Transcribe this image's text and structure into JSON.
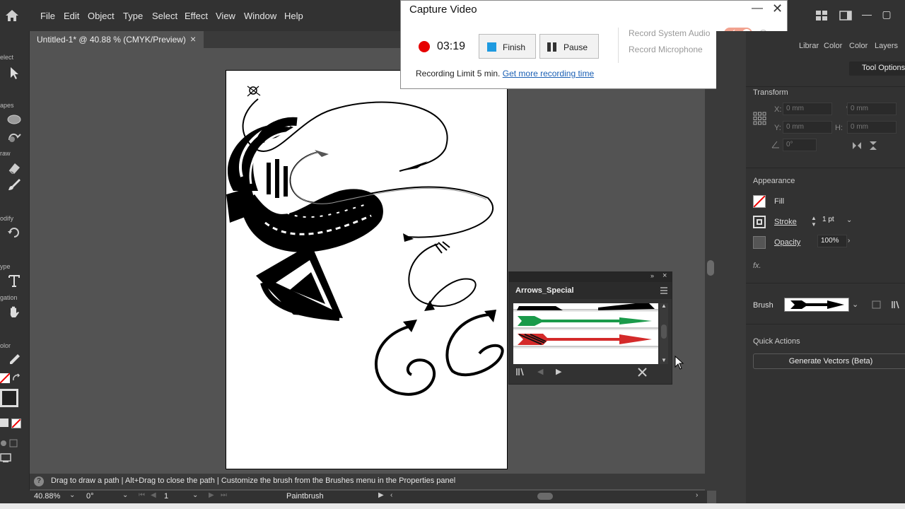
{
  "menu": {
    "items": [
      "File",
      "Edit",
      "Object",
      "Type",
      "Select",
      "Effect",
      "View",
      "Window",
      "Help"
    ]
  },
  "document": {
    "tab_title": "Untitled-1* @ 40.88 % (CMYK/Preview)",
    "close_glyph": "×"
  },
  "toolbar": {
    "headings": [
      "elect",
      "apes",
      "raw",
      "odify",
      "ype",
      "gation",
      "olor"
    ]
  },
  "capture": {
    "title": "Capture Video",
    "minimize_glyph": "—",
    "close_glyph": "✕",
    "time": "03:19",
    "finish_label": "Finish",
    "pause_label": "Pause",
    "record_system_audio": "Record System Audio",
    "record_microphone": "Record Microphone",
    "system_audio_on": true,
    "microphone_on": false,
    "limit_text": "Recording Limit 5 min.",
    "limit_link": "Get more recording time",
    "accent": "#1e9ae0",
    "record_color": "#e60000"
  },
  "right_panel": {
    "tabs": [
      "Librar",
      "Color",
      "Color",
      "Layers"
    ],
    "tool_options": "Tool Options",
    "transform": {
      "title": "Transform",
      "x_label": "X:",
      "x_value": "0 mm",
      "y_label": "Y:",
      "y_value": "0 mm",
      "w_label": "W:",
      "w_value": "0 mm",
      "h_label": "H:",
      "h_value": "0 mm",
      "angle_value": "0°"
    },
    "appearance": {
      "title": "Appearance",
      "fill_label": "Fill",
      "stroke_label": "Stroke",
      "stroke_value": "1 pt",
      "opacity_label": "Opacity",
      "opacity_value": "100%",
      "fx_label": "fx."
    },
    "brush_label": "Brush",
    "quick_actions": {
      "title": "Quick Actions",
      "generate_button": "Generate Vectors (Beta)"
    }
  },
  "brush_panel": {
    "tab": "Arrows_Special",
    "arrow_colors": [
      "#000000",
      "#1a9a4a",
      "#d42a2a"
    ]
  },
  "status": {
    "help_glyph": "?",
    "text": "Drag to draw a path  |  Alt+Drag to close the path  |  Customize the brush from the Brushes menu in the Properties panel"
  },
  "bottom": {
    "zoom": "40.88%",
    "rotation": "0°",
    "artboard": "1",
    "tool": "Paintbrush"
  }
}
